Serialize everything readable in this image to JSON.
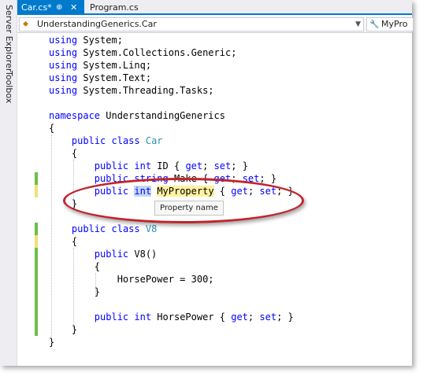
{
  "sidebar": {
    "server_explorer": "Server Explorer",
    "toolbox": "Toolbox"
  },
  "tabs": [
    {
      "label": "Car.cs*",
      "pin": "⊕",
      "close": "✕"
    },
    {
      "label": "Program.cs"
    }
  ],
  "navbar": {
    "scope": "UnderstandingGenerics.Car",
    "member": "MyPro"
  },
  "code_lines": [
    [
      {
        "t": "using",
        "c": "kw"
      },
      {
        "t": " System;"
      }
    ],
    [
      {
        "t": "using",
        "c": "kw"
      },
      {
        "t": " System.Collections.Generic;"
      }
    ],
    [
      {
        "t": "using",
        "c": "kw"
      },
      {
        "t": " System.Linq;"
      }
    ],
    [
      {
        "t": "using",
        "c": "kw"
      },
      {
        "t": " System.Text;"
      }
    ],
    [
      {
        "t": "using",
        "c": "kw"
      },
      {
        "t": " System.Threading.Tasks;"
      }
    ],
    [],
    [
      {
        "t": "namespace",
        "c": "kw"
      },
      {
        "t": " UnderstandingGenerics"
      }
    ],
    [
      {
        "t": "{"
      }
    ],
    [
      {
        "t": "    "
      },
      {
        "t": "public",
        "c": "kw"
      },
      {
        "t": " "
      },
      {
        "t": "class",
        "c": "kw"
      },
      {
        "t": " "
      },
      {
        "t": "Car",
        "c": "ty"
      }
    ],
    [
      {
        "t": "    {"
      }
    ],
    [
      {
        "t": "        "
      },
      {
        "t": "public",
        "c": "kw"
      },
      {
        "t": " "
      },
      {
        "t": "int",
        "c": "kw"
      },
      {
        "t": " ID { "
      },
      {
        "t": "get",
        "c": "kw"
      },
      {
        "t": "; "
      },
      {
        "t": "set",
        "c": "kw"
      },
      {
        "t": "; }"
      }
    ],
    [
      {
        "t": "        "
      },
      {
        "t": "public",
        "c": "kw"
      },
      {
        "t": " "
      },
      {
        "t": "string",
        "c": "kw"
      },
      {
        "t": " Make { "
      },
      {
        "t": "get",
        "c": "kw"
      },
      {
        "t": "; "
      },
      {
        "t": "set",
        "c": "kw"
      },
      {
        "t": "; }"
      }
    ],
    [
      {
        "t": "        "
      },
      {
        "t": "public",
        "c": "kw"
      },
      {
        "t": " "
      },
      {
        "t": "int",
        "c": "kw sel"
      },
      {
        "t": " "
      },
      {
        "t": "MyProperty",
        "c": "myprop"
      },
      {
        "t": " { "
      },
      {
        "t": "get",
        "c": "kw"
      },
      {
        "t": "; "
      },
      {
        "t": "set",
        "c": "kw"
      },
      {
        "t": "; }"
      }
    ],
    [
      {
        "t": "    }"
      }
    ],
    [],
    [
      {
        "t": "    "
      },
      {
        "t": "public",
        "c": "kw"
      },
      {
        "t": " "
      },
      {
        "t": "class",
        "c": "kw"
      },
      {
        "t": " "
      },
      {
        "t": "V8",
        "c": "ty"
      }
    ],
    [
      {
        "t": "    {"
      }
    ],
    [
      {
        "t": "        "
      },
      {
        "t": "public",
        "c": "kw"
      },
      {
        "t": " V8()"
      }
    ],
    [
      {
        "t": "        {"
      }
    ],
    [
      {
        "t": "            HorsePower = 300;"
      }
    ],
    [
      {
        "t": "        }"
      }
    ],
    [],
    [
      {
        "t": "        "
      },
      {
        "t": "public",
        "c": "kw"
      },
      {
        "t": " "
      },
      {
        "t": "int",
        "c": "kw"
      },
      {
        "t": " HorsePower { "
      },
      {
        "t": "get",
        "c": "kw"
      },
      {
        "t": "; "
      },
      {
        "t": "set",
        "c": "kw"
      },
      {
        "t": "; }"
      }
    ],
    [
      {
        "t": "    }"
      }
    ],
    [
      {
        "t": "}"
      }
    ]
  ],
  "tooltip": "Property name",
  "colors": {
    "accent": "#007acc",
    "keyword": "#0000ff",
    "type": "#2b91af",
    "highlight_ellipse": "#c0252b",
    "saved_change": "#6cc04a",
    "unsaved_change": "#f2e07a"
  }
}
